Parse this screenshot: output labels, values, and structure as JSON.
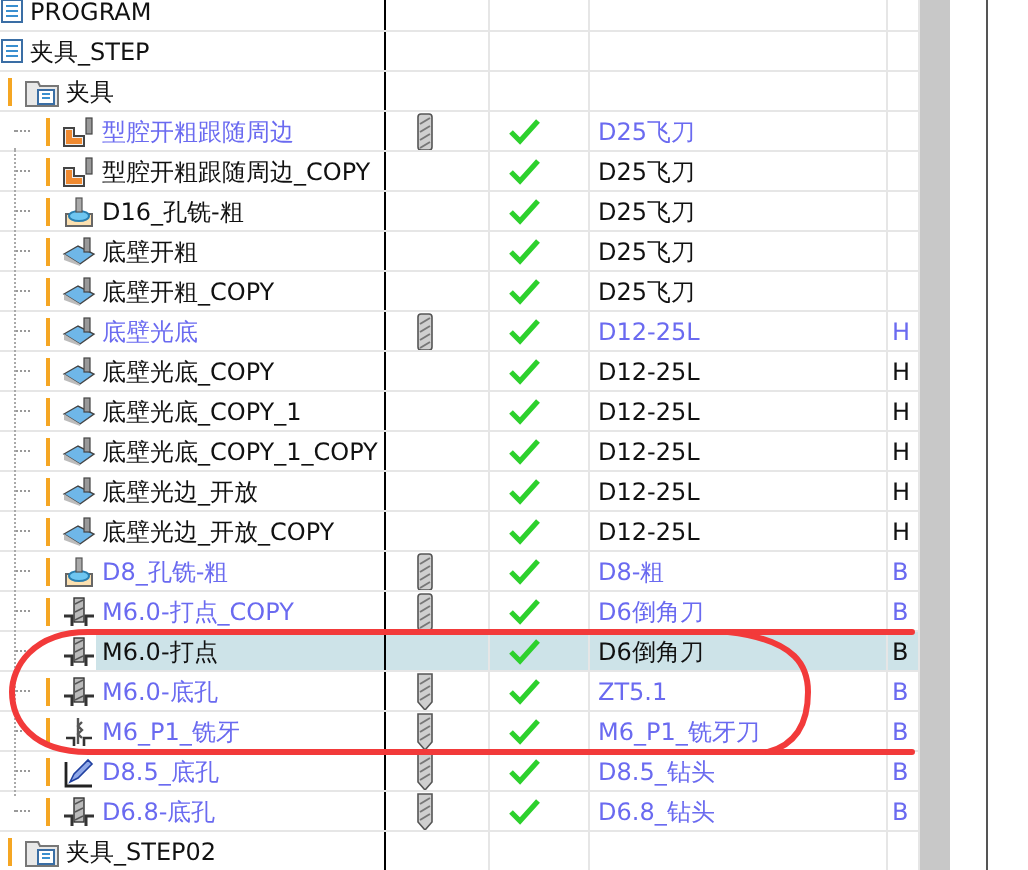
{
  "tree": [
    {
      "kind": "program",
      "label": "PROGRAM"
    },
    {
      "kind": "program",
      "label": "夹具_STEP",
      "children": [
        {
          "kind": "group",
          "label": "夹具",
          "warn": true,
          "children": [
            {
              "kind": "cavity",
              "label": "型腔开粗跟随周边",
              "warn": true,
              "modified": true,
              "selected": false,
              "tool_icon": {
                "kind": "endmill"
              },
              "done": true,
              "tool": "D25飞刀"
            },
            {
              "kind": "cavity",
              "label": "型腔开粗跟随周边_COPY",
              "warn": true,
              "modified": false,
              "selected": false,
              "done": true,
              "tool": "D25飞刀"
            },
            {
              "kind": "hole",
              "label": "D16_孔铣-粗",
              "warn": true,
              "modified": false,
              "selected": false,
              "done": true,
              "tool": "D25飞刀"
            },
            {
              "kind": "floor",
              "label": "底壁开粗",
              "warn": true,
              "modified": false,
              "selected": false,
              "done": true,
              "tool": "D25飞刀"
            },
            {
              "kind": "floor",
              "label": "底壁开粗_COPY",
              "warn": true,
              "modified": false,
              "selected": false,
              "done": true,
              "tool": "D25飞刀"
            },
            {
              "kind": "floor",
              "label": "底壁光底",
              "warn": true,
              "modified": true,
              "selected": false,
              "tool_icon": {
                "kind": "endmill"
              },
              "done": true,
              "tool": "D12-25L",
              "column_5": "H"
            },
            {
              "kind": "floor",
              "label": "底壁光底_COPY",
              "warn": true,
              "modified": false,
              "selected": false,
              "done": true,
              "tool": "D12-25L",
              "column_5": "H"
            },
            {
              "kind": "floor",
              "label": "底壁光底_COPY_1",
              "warn": true,
              "modified": false,
              "selected": false,
              "done": true,
              "tool": "D12-25L",
              "column_5": "H"
            },
            {
              "kind": "floor",
              "label": "底壁光底_COPY_1_COPY",
              "warn": true,
              "modified": false,
              "selected": false,
              "done": true,
              "tool": "D12-25L",
              "column_5": "H"
            },
            {
              "kind": "floor",
              "label": "底壁光边_开放",
              "warn": true,
              "modified": false,
              "selected": false,
              "done": true,
              "tool": "D12-25L",
              "column_5": "H"
            },
            {
              "kind": "floor",
              "label": "底壁光边_开放_COPY",
              "warn": true,
              "modified": false,
              "selected": false,
              "done": true,
              "tool": "D12-25L",
              "column_5": "H"
            },
            {
              "kind": "hole",
              "label": "D8_孔铣-粗",
              "warn": true,
              "modified": true,
              "selected": false,
              "tool_icon": {
                "kind": "endmill"
              },
              "done": true,
              "tool": "D8-粗",
              "column_5": "B"
            },
            {
              "kind": "drill",
              "label": "M6.0-打点_COPY",
              "warn": true,
              "modified": true,
              "selected": false,
              "tool_icon": {
                "kind": "endmill"
              },
              "done": true,
              "tool": "D6倒角刀",
              "column_5": "B"
            },
            {
              "kind": "drill",
              "label": "M6.0-打点",
              "warn": false,
              "modified": false,
              "selected": true,
              "done": true,
              "tool": "D6倒角刀",
              "column_5": "B"
            },
            {
              "kind": "drill",
              "label": "M6.0-底孔",
              "warn": true,
              "modified": true,
              "selected": false,
              "tool_icon": {
                "kind": "drill"
              },
              "done": true,
              "tool": "ZT5.1",
              "column_5": "B"
            },
            {
              "kind": "thread",
              "label": "M6_P1_铣牙",
              "warn": true,
              "modified": true,
              "selected": false,
              "tool_icon": {
                "kind": "drill"
              },
              "done": true,
              "tool": "M6_P1_铣牙刀",
              "column_5": "B"
            },
            {
              "kind": "custom",
              "label": "D8.5_底孔",
              "warn": true,
              "modified": true,
              "selected": false,
              "tool_icon": {
                "kind": "drill"
              },
              "done": true,
              "tool": "D8.5_钻头",
              "column_5": "B"
            },
            {
              "kind": "drill",
              "label": "D6.8-底孔",
              "warn": true,
              "modified": true,
              "selected": false,
              "tool_icon": {
                "kind": "drill"
              },
              "done": true,
              "tool": "D6.8_钻头",
              "column_5": "B"
            }
          ]
        },
        {
          "kind": "group",
          "label": "夹具_STEP02",
          "warn": true
        }
      ]
    }
  ]
}
